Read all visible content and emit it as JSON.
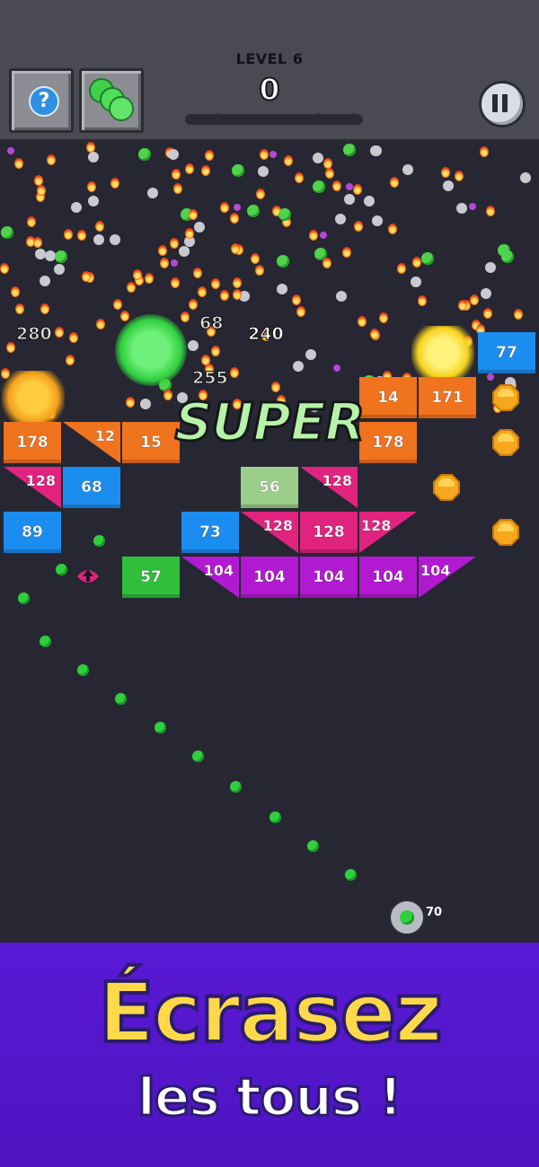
{
  "hud": {
    "level_label": "LEVEL 6",
    "score": "0",
    "help_icon": "question-mark-icon",
    "balls_icon": "green-balls-icon",
    "pause_icon": "pause-icon"
  },
  "colors": {
    "orange": "#f0731e",
    "pink": "#e0237e",
    "blue": "#1c8df0",
    "green": "#2fbf3a",
    "purple": "#b21ad2",
    "lightgreen": "#9ccf8a",
    "banner": "#5a19d6",
    "headline": "#ffd94a"
  },
  "field": {
    "combo_text": "SUPER",
    "floating_numbers": [
      "240",
      "68",
      "255",
      "280"
    ],
    "ball_count": "70",
    "gem_icon": "gold-gem-icon",
    "boost_icon": "pink-arrow-boost-icon",
    "bricks": {
      "b77": "77",
      "b14": "14",
      "b171": "171",
      "b178a": "178",
      "b12": "12",
      "b15": "15",
      "b178b": "178",
      "b128a": "128",
      "b68": "68",
      "b56": "56",
      "b128b": "128",
      "b89": "89",
      "b73": "73",
      "b128c": "128",
      "b128d": "128",
      "b128e": "128",
      "b57": "57",
      "b104a": "104",
      "b104b": "104",
      "b104c": "104",
      "b104d": "104",
      "b104e": "104"
    }
  },
  "banner": {
    "headline": "Écrasez",
    "subline": "les tous !"
  }
}
